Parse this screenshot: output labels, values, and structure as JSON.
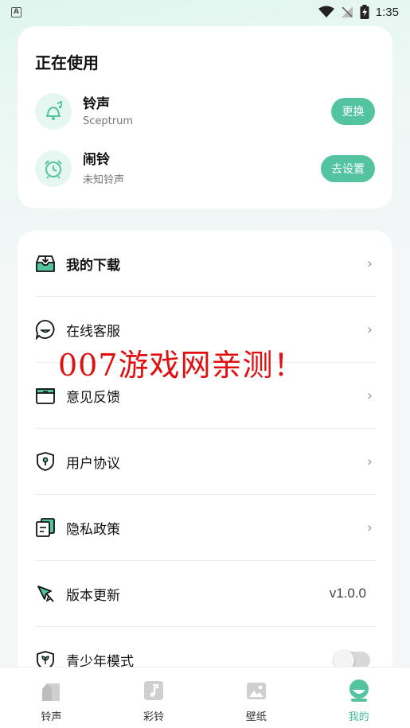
{
  "status_bar": {
    "left_icon": "A",
    "time": "1:35"
  },
  "using": {
    "title": "正在使用",
    "items": [
      {
        "name": "铃声",
        "sub": "Sceptrum",
        "button": "更换",
        "icon": "bell-music-icon"
      },
      {
        "name": "闹铃",
        "sub": "未知铃声",
        "button": "去设置",
        "icon": "alarm-clock-icon"
      }
    ]
  },
  "menu": {
    "items": [
      {
        "label": "我的下载",
        "icon": "download-tray-icon"
      },
      {
        "label": "在线客服",
        "icon": "chat-bubble-icon"
      },
      {
        "label": "意见反馈",
        "icon": "feedback-box-icon"
      },
      {
        "label": "用户协议",
        "icon": "shield-icon"
      },
      {
        "label": "隐私政策",
        "icon": "documents-icon"
      },
      {
        "label": "版本更新",
        "icon": "rocket-icon",
        "value": "v1.0.0"
      },
      {
        "label": "青少年模式",
        "icon": "youth-shield-icon",
        "toggle": false
      }
    ],
    "chevron": "›"
  },
  "watermark": "007游戏网亲测！",
  "nav": {
    "items": [
      {
        "label": "铃声",
        "icon": "house-icon",
        "active": false
      },
      {
        "label": "彩铃",
        "icon": "music-note-icon",
        "active": false
      },
      {
        "label": "壁纸",
        "icon": "picture-icon",
        "active": false
      },
      {
        "label": "我的",
        "icon": "profile-face-icon",
        "active": true
      }
    ]
  },
  "colors": {
    "accent": "#53c49f",
    "active_nav": "#3fbf95"
  }
}
